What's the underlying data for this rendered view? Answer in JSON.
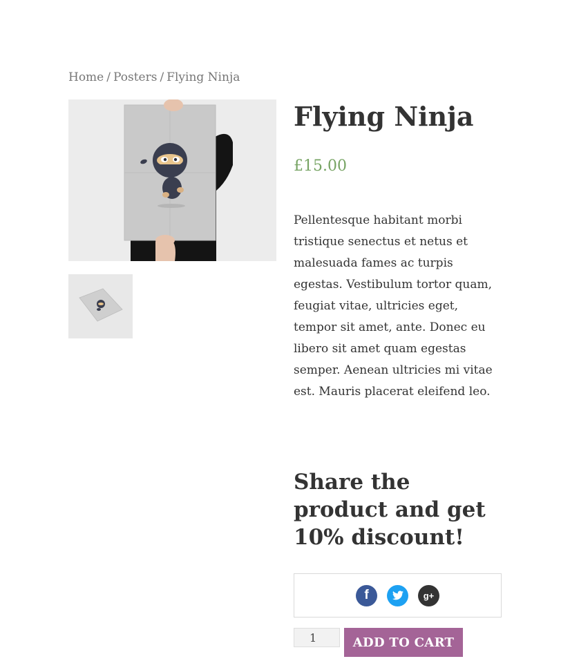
{
  "breadcrumb": {
    "home": "Home",
    "separator": "/",
    "category": "Posters",
    "current": "Flying Ninja"
  },
  "product": {
    "title": "Flying Ninja",
    "price": "£15.00",
    "description": "Pellentesque habitant morbi tristique senectus et netus et malesuada fames ac turpis egestas. Vestibulum tortor quam, feugiat vitae, ultricies eget, tempor sit amet, ante. Donec eu libero sit amet quam egestas semper. Aenean ultricies mi vitae est. Mauris placerat eleifend leo."
  },
  "share": {
    "heading": "Share the product and get 10% discount!",
    "icons": [
      "facebook-icon",
      "twitter-icon",
      "google-plus-icon"
    ],
    "facebook_glyph": "f",
    "google_glyph": "g+"
  },
  "cart": {
    "quantity": "1",
    "add_label": "ADD TO CART"
  },
  "colors": {
    "price": "#77a464",
    "button": "#a46497",
    "facebook": "#3b5998",
    "twitter": "#1da1f2",
    "google": "#333333"
  }
}
